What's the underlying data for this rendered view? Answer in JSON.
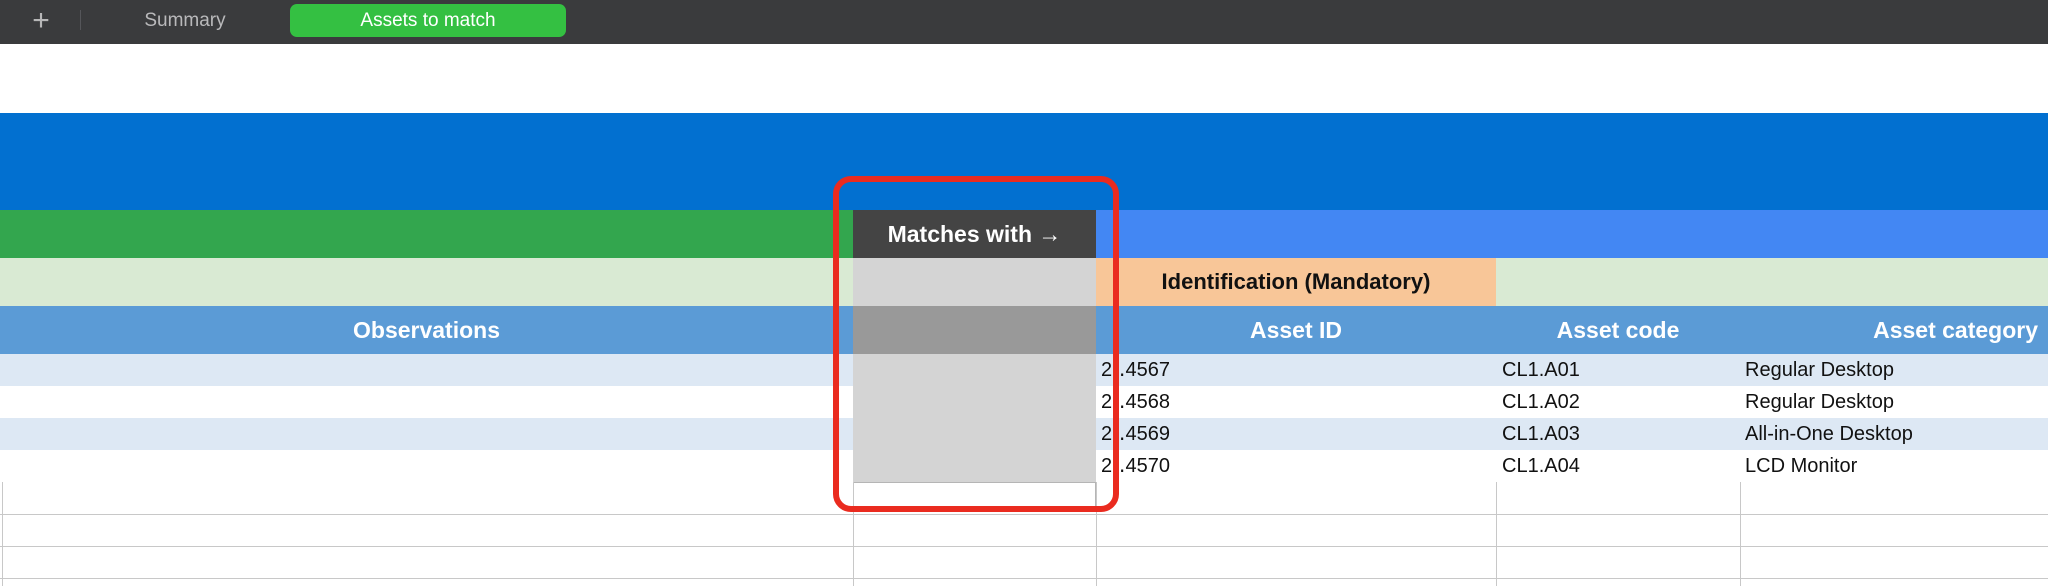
{
  "tabs": {
    "add_label": "+",
    "summary_label": "Summary",
    "assets_label": "Assets to match"
  },
  "headers": {
    "matches_with": "Matches with →",
    "identification_group": "Identification (Mandatory)",
    "observations": "Observations",
    "asset_id": "Asset ID",
    "asset_code": "Asset code",
    "asset_category": "Asset category"
  },
  "rows": [
    {
      "asset_id": "2‥4567",
      "asset_code": "CL1.A01",
      "asset_category": "Regular Desktop"
    },
    {
      "asset_id": "2‥4568",
      "asset_code": "CL1.A02",
      "asset_category": "Regular Desktop"
    },
    {
      "asset_id": "2‥4569",
      "asset_code": "CL1.A03",
      "asset_category": "All-in-One Desktop"
    },
    {
      "asset_id": "2‥4570",
      "asset_code": "CL1.A04",
      "asset_category": "LCD Monitor"
    }
  ],
  "colors": {
    "tab_bar": "#3a3b3d",
    "active_tab": "#34c042",
    "title_band": "#0270d0",
    "green_band": "#33a64e",
    "header_band": "#5b9bd6",
    "orange_group": "#f8c698",
    "highlight": "#ea2b1f"
  }
}
